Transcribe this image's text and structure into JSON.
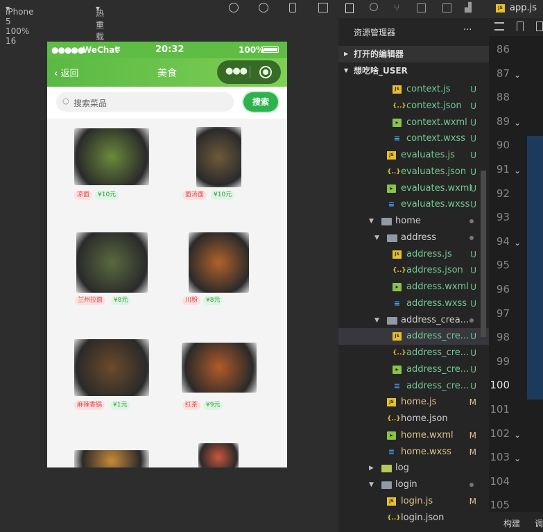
{
  "simulator": {
    "device": "iPhone 5 100% 16",
    "hot_reload": "热重载 开",
    "status": {
      "carrier": "WeChat",
      "time": "20:32",
      "battery": "100%"
    },
    "nav": {
      "back": "返回",
      "title": "美食"
    },
    "search": {
      "placeholder": "搜索菜品",
      "button": "搜索"
    },
    "foods": [
      {
        "name": "凉面",
        "price": "¥10元",
        "color": "#6b8a3a"
      },
      {
        "name": "面汤面",
        "price": "¥10元",
        "color": "#6e5a3a"
      },
      {
        "name": "兰州拉面",
        "price": "¥8元",
        "color": "#5a6a3f"
      },
      {
        "name": "川粉",
        "price": "¥8元",
        "color": "#b0622a"
      },
      {
        "name": "麻辣香锅",
        "price": "¥1元",
        "color": "#6b4a2a"
      },
      {
        "name": "红茶",
        "price": "¥9元",
        "color": "#b25a28"
      },
      {
        "name": "",
        "price": "",
        "color": "#c88a3a"
      },
      {
        "name": "",
        "price": "",
        "color": "#c9573c"
      }
    ]
  },
  "explorer": {
    "title": "资源管理器",
    "more": "···",
    "open_editors": "打开的编辑器",
    "project": "想吃啥_USER",
    "rows": [
      {
        "label": "context.js",
        "type": "js",
        "indent": 3,
        "status": "U"
      },
      {
        "label": "context.json",
        "type": "json",
        "indent": 3,
        "status": "U"
      },
      {
        "label": "context.wxml",
        "type": "wxml",
        "indent": 3,
        "status": "U"
      },
      {
        "label": "context.wxss",
        "type": "wxss",
        "indent": 3,
        "status": "U"
      },
      {
        "label": "evaluates.js",
        "type": "js",
        "indent": 2,
        "status": "U"
      },
      {
        "label": "evaluates.json",
        "type": "json",
        "indent": 2,
        "status": "U"
      },
      {
        "label": "evaluates.wxml",
        "type": "wxml",
        "indent": 2,
        "status": "U"
      },
      {
        "label": "evaluates.wxss",
        "type": "wxss",
        "indent": 2,
        "status": "U"
      },
      {
        "label": "home",
        "type": "folder",
        "indent": 1,
        "status": "dot",
        "chevron": "v"
      },
      {
        "label": "address",
        "type": "folder",
        "indent": 2,
        "status": "dot",
        "chevron": "v"
      },
      {
        "label": "address.js",
        "type": "js",
        "indent": 3,
        "status": "U"
      },
      {
        "label": "address.json",
        "type": "json",
        "indent": 3,
        "status": "U"
      },
      {
        "label": "address.wxml",
        "type": "wxml",
        "indent": 3,
        "status": "U"
      },
      {
        "label": "address.wxss",
        "type": "wxss",
        "indent": 3,
        "status": "U"
      },
      {
        "label": "address_crea...",
        "type": "folder",
        "indent": 2,
        "status": "dot",
        "chevron": "v"
      },
      {
        "label": "address_cre...",
        "type": "js",
        "indent": 3,
        "status": "U",
        "selected": true
      },
      {
        "label": "address_cre...",
        "type": "json",
        "indent": 3,
        "status": "U"
      },
      {
        "label": "address_cre...",
        "type": "wxml",
        "indent": 3,
        "status": "U"
      },
      {
        "label": "address_cre...",
        "type": "wxss",
        "indent": 3,
        "status": "U"
      },
      {
        "label": "home.js",
        "type": "js",
        "indent": 2,
        "status": "M"
      },
      {
        "label": "home.json",
        "type": "json",
        "indent": 2,
        "status": ""
      },
      {
        "label": "home.wxml",
        "type": "wxml",
        "indent": 2,
        "status": "M"
      },
      {
        "label": "home.wxss",
        "type": "wxss",
        "indent": 2,
        "status": "M"
      },
      {
        "label": "log",
        "type": "folder-log",
        "indent": 1,
        "status": "",
        "chevron": ">"
      },
      {
        "label": "login",
        "type": "folder",
        "indent": 1,
        "status": "dot",
        "chevron": "v"
      },
      {
        "label": "login.js",
        "type": "js",
        "indent": 2,
        "status": "M"
      },
      {
        "label": "login.json",
        "type": "json",
        "indent": 2,
        "status": ""
      }
    ]
  },
  "editor": {
    "tab": "app.js",
    "line_numbers": [
      "86",
      "87",
      "88",
      "89",
      "90",
      "91",
      "92",
      "93",
      "94",
      "95",
      "96",
      "97",
      "98",
      "99",
      "100",
      "101",
      "102",
      "103",
      "104",
      "105"
    ],
    "current_line": "100",
    "bottom_tabs": [
      "构建",
      "调"
    ]
  }
}
